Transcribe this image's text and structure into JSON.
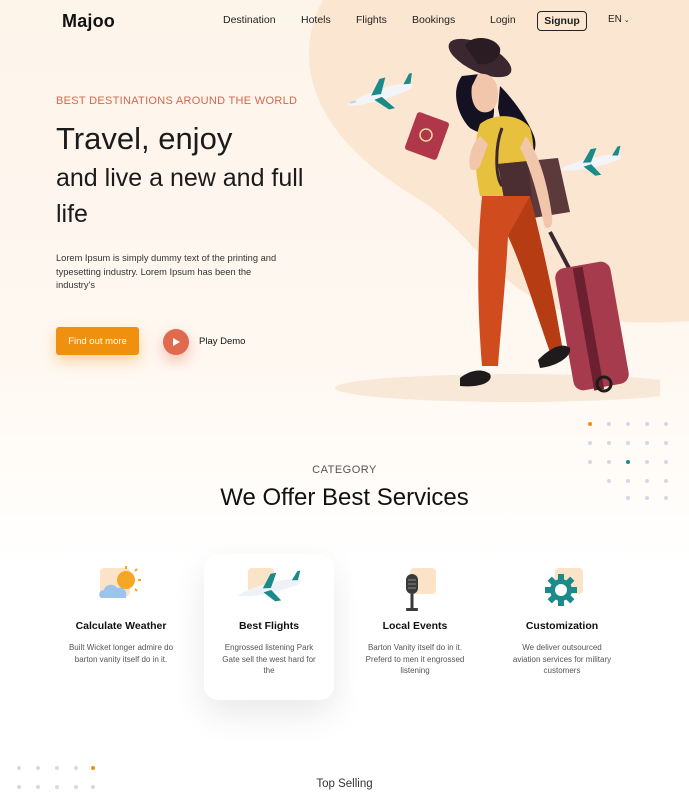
{
  "header": {
    "logo": "Majoo",
    "nav": [
      "Destination",
      "Hotels",
      "Flights",
      "Bookings"
    ],
    "login": "Login",
    "signup": "Signup",
    "language": "EN"
  },
  "hero": {
    "eyebrow": "BEST DESTINATIONS AROUND THE WORLD",
    "title_line1": "Travel, enjoy",
    "title_rest": "and live a new and full life",
    "lead": "Lorem Ipsum is simply dummy text of the printing and typesetting industry. Lorem Ipsum has been the industry's",
    "cta": "Find out more",
    "demo": "Play Demo"
  },
  "services": {
    "category": "CATEGORY",
    "title": "We Offer Best Services",
    "cards": [
      {
        "title": "Calculate Weather",
        "desc": "Built Wicket longer admire do barton vanity itself do in it.",
        "icon": "weather-icon"
      },
      {
        "title": "Best Flights",
        "desc": "Engrossed listening Park Gate sell the west hard for the",
        "icon": "airplane-icon"
      },
      {
        "title": "Local Events",
        "desc": "Barton  Vanity itself do in it. Preferd to men it engrossed listening",
        "icon": "microphone-icon"
      },
      {
        "title": "Customization",
        "desc": "We deliver outsourced aviation services for military customers",
        "icon": "gear-icon"
      }
    ]
  },
  "next_section": {
    "title": "Top Selling"
  },
  "colors": {
    "accent": "#f0900f",
    "coral": "#e06a4e",
    "teal": "#1a8a8a",
    "eyebrow": "#d4674d"
  }
}
